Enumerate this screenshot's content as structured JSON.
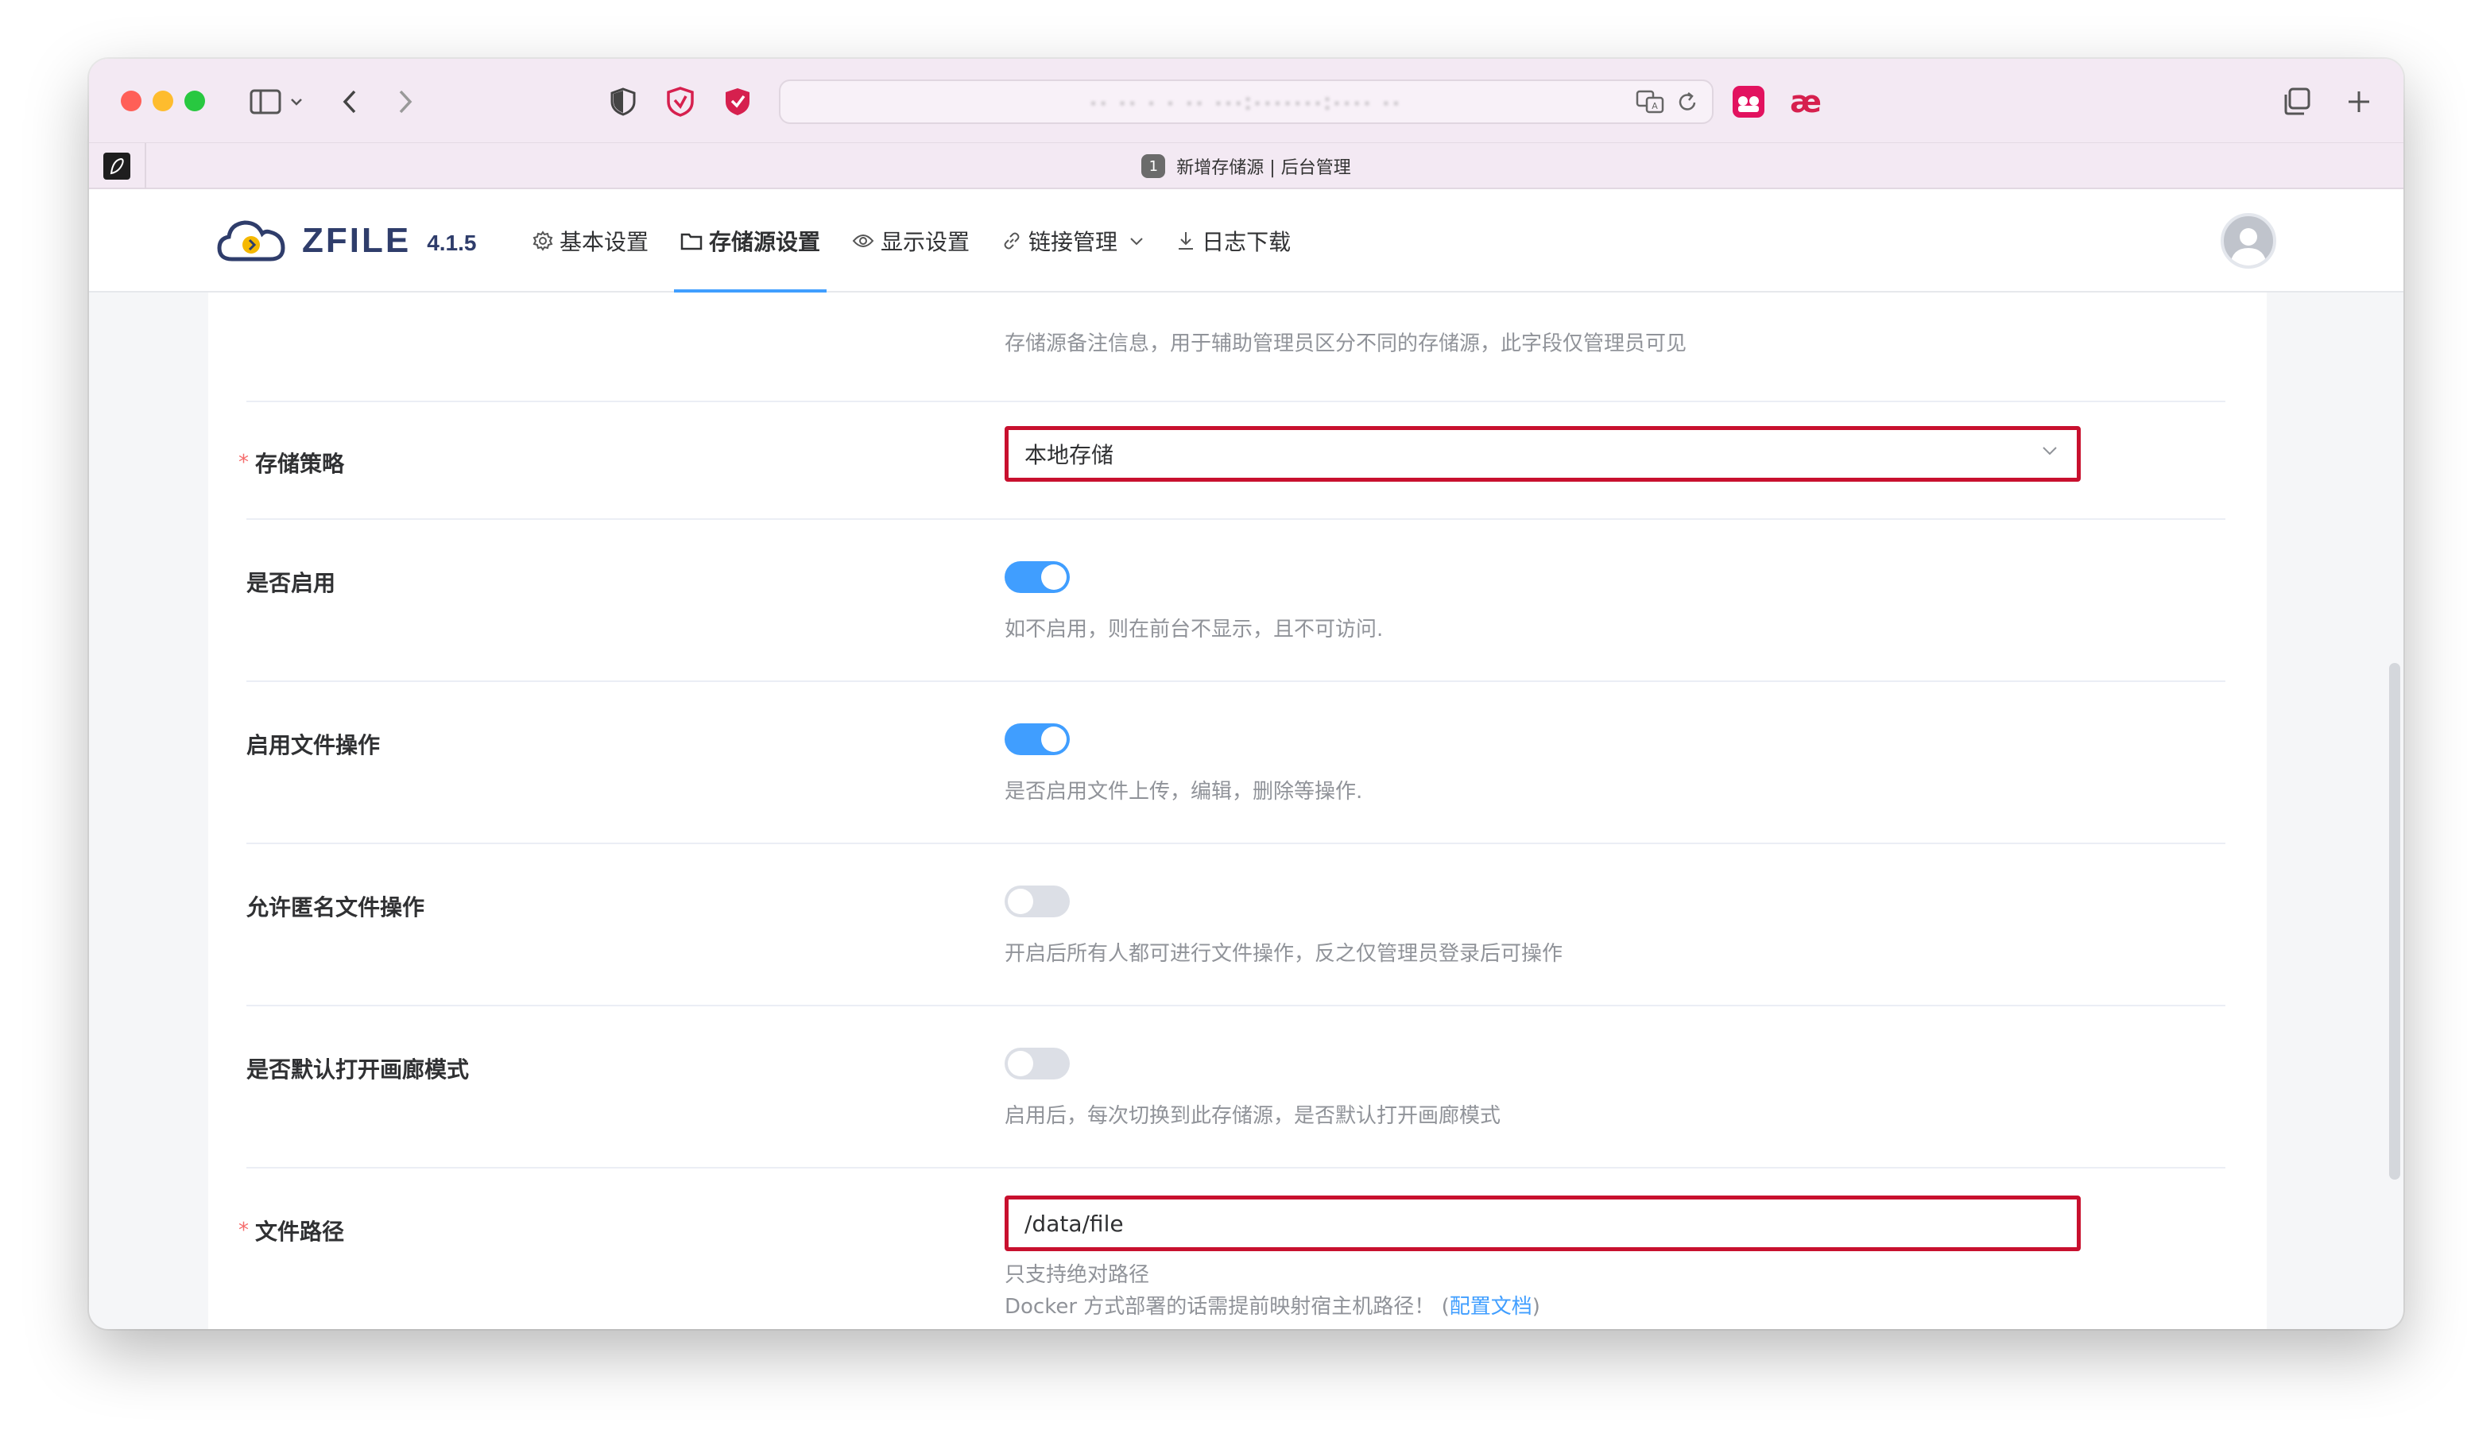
{
  "browser": {
    "address_text": "·· ·· · ·  ·· ···:·······:···· ··",
    "tab_number": "1",
    "tab_title": "新增存储源 | 后台管理"
  },
  "app": {
    "logo_name": "ZFILE",
    "version": "4.1.5",
    "menu": [
      {
        "label": "基本设置",
        "icon": "gear-icon"
      },
      {
        "label": "存储源设置",
        "icon": "folder-icon",
        "active": true
      },
      {
        "label": "显示设置",
        "icon": "eye-icon"
      },
      {
        "label": "链接管理",
        "icon": "link-icon",
        "has_dropdown": true
      },
      {
        "label": "日志下载",
        "icon": "download-icon"
      }
    ]
  },
  "form": {
    "cut_help": "存储源备注信息，用于辅助管理员区分不同的存储源，此字段仅管理员可见",
    "storage_strategy": {
      "label": "存储策略",
      "required_mark": "*",
      "value": "本地存储"
    },
    "enable": {
      "label": "是否启用",
      "state": "on",
      "help": "如不启用，则在前台不显示，且不可访问."
    },
    "file_ops": {
      "label": "启用文件操作",
      "state": "on",
      "help": "是否启用文件上传，编辑，删除等操作."
    },
    "anon_ops": {
      "label": "允许匿名文件操作",
      "state": "off",
      "help": "开启后所有人都可进行文件操作，反之仅管理员登录后可操作"
    },
    "gallery": {
      "label": "是否默认打开画廊模式",
      "state": "off",
      "help": "启用后，每次切换到此存储源，是否默认打开画廊模式"
    },
    "file_path": {
      "label": "文件路径",
      "required_mark": "*",
      "value": "/data/file",
      "help_line1": "只支持绝对路径",
      "help_line2_prefix": "Docker 方式部署的话需提前映射宿主机路径！ (",
      "help_link": "配置文档",
      "help_line2_suffix": ")"
    }
  },
  "colors": {
    "accent": "#409eff",
    "highlight_border": "#c8102e",
    "required": "#f56c6c"
  }
}
